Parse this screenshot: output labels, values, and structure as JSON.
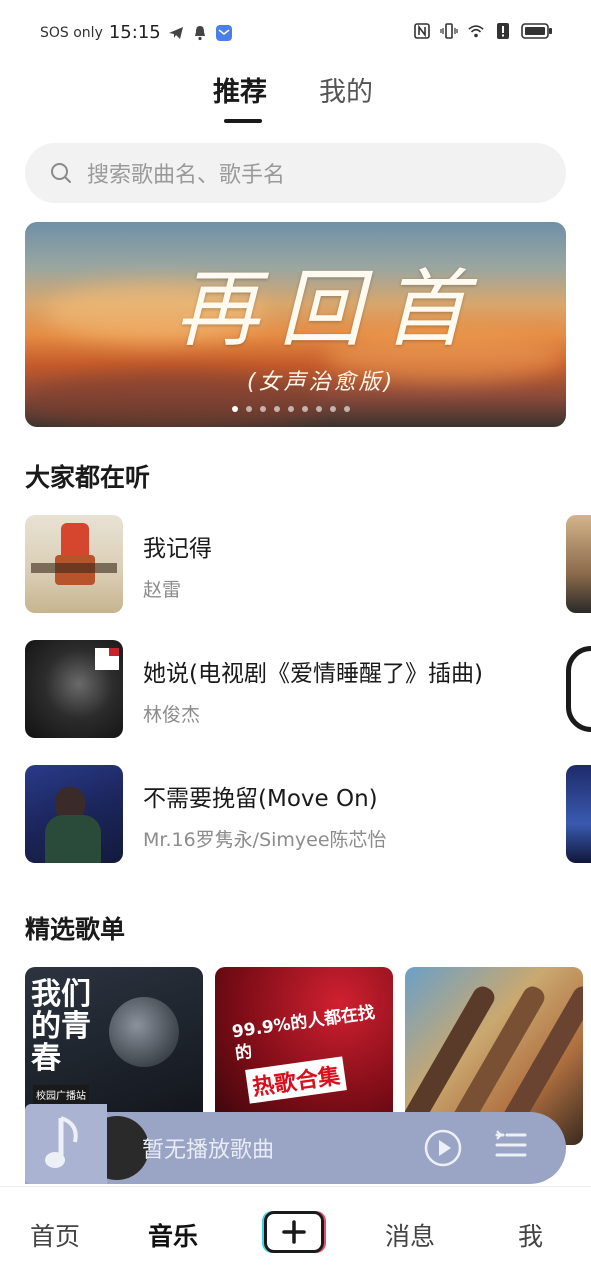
{
  "status_bar": {
    "sos": "SOS only",
    "time": "15:15",
    "left_icons": [
      "telegram-icon",
      "bell-icon",
      "mail-app-icon"
    ],
    "right_icons": [
      "nfc-icon",
      "vibrate-icon",
      "wifi-icon",
      "alert-icon",
      "battery-icon"
    ]
  },
  "tabs": [
    {
      "label": "推荐",
      "active": true
    },
    {
      "label": "我的",
      "active": false
    }
  ],
  "search": {
    "placeholder": "搜索歌曲名、歌手名"
  },
  "banner": {
    "title": "再回首",
    "subtitle": "(女声治愈版)",
    "dot_count": 9,
    "active_dot": 0
  },
  "listening": {
    "title": "大家都在听",
    "songs": [
      {
        "title": "我记得",
        "artist": "赵雷"
      },
      {
        "title": "她说(电视剧《爱情睡醒了》插曲)",
        "artist": "林俊杰"
      },
      {
        "title": "不需要挽留(Move On)",
        "artist": "Mr.16罗隽永/Simyee陈芯怡"
      }
    ]
  },
  "playlists": {
    "title": "精选歌单",
    "items": [
      {
        "cover_text": "我们的青春",
        "cover_sub": "校园广播站"
      },
      {
        "cover_text": "99.9%的人都在找的",
        "cover_sub": "热歌合集"
      },
      {
        "cover_text": "",
        "cover_sub": ""
      }
    ]
  },
  "player": {
    "text": "暂无播放歌曲"
  },
  "bottom_nav": [
    {
      "label": "首页",
      "active": false
    },
    {
      "label": "音乐",
      "active": true
    },
    {
      "label": "+",
      "active": false
    },
    {
      "label": "消息",
      "active": false
    },
    {
      "label": "我",
      "active": false
    }
  ],
  "colors": {
    "accent": "#1a1a1a",
    "player_bg": "#9aa4c4",
    "search_bg": "#f2f2f2"
  }
}
